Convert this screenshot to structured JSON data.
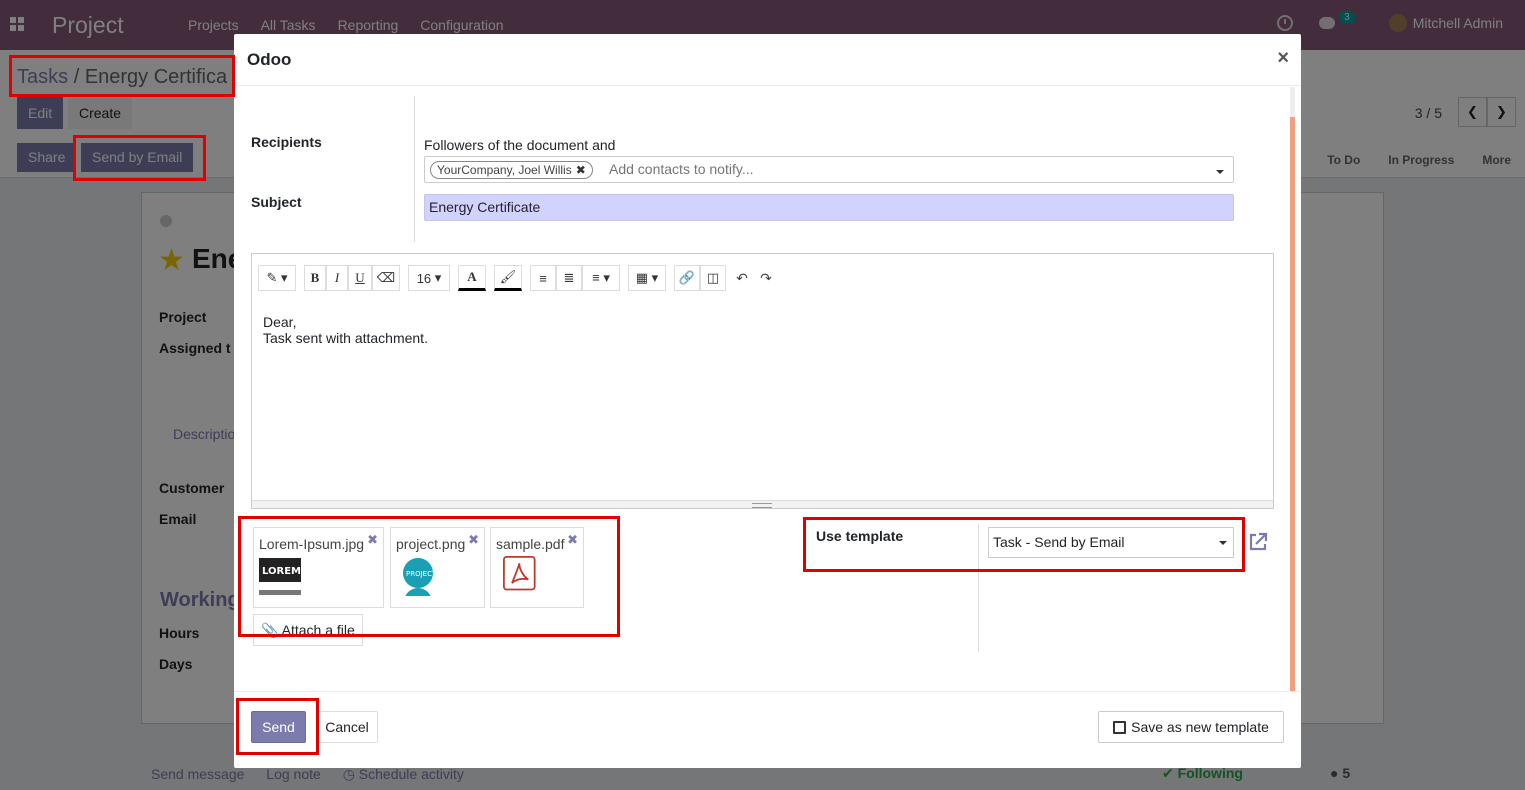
{
  "navbar": {
    "brand": "Project",
    "menu": [
      "Projects",
      "All Tasks",
      "Reporting",
      "Configuration"
    ],
    "chat_count": "3",
    "user": "Mitchell Admin"
  },
  "control_panel": {
    "breadcrumb_parent": "Tasks",
    "breadcrumb_sep": "/",
    "breadcrumb_current": "Energy Certifica",
    "edit_label": "Edit",
    "create_label": "Create",
    "share_label": "Share",
    "send_by_email_label": "Send by Email",
    "pager": "3 / 5",
    "stages": [
      "To Do",
      "In Progress",
      "More"
    ]
  },
  "sheet": {
    "title_fragment": "Ene",
    "project_label": "Project",
    "assigned_label": "Assigned t",
    "description_tab": "Descriptio",
    "customer_label": "Customer",
    "email_label": "Email",
    "working_heading": "Working",
    "hours_label": "Hours",
    "days_label": "Days"
  },
  "chatter": {
    "send_message": "Send message",
    "log_note": "Log note",
    "schedule_activity": "Schedule activity",
    "following": "Following",
    "followers_count": "5"
  },
  "modal": {
    "title": "Odoo",
    "close": "×",
    "recipients_label": "Recipients",
    "followers_text": "Followers of the document and",
    "recipient_tag": "YourCompany, Joel Willis",
    "recipient_placeholder": "Add contacts to notify...",
    "subject_label": "Subject",
    "subject_value": "Energy Certificate",
    "toolbar": {
      "font_size": "16"
    },
    "body_lines": [
      "Dear,",
      "Task sent with attachment."
    ],
    "attachments": [
      {
        "name": "Lorem-Ipsum.jpg"
      },
      {
        "name": "project.png"
      },
      {
        "name": "sample.pdf"
      }
    ],
    "attach_button": "Attach a file",
    "use_template_label": "Use template",
    "template_value": "Task - Send by Email",
    "send_label": "Send",
    "cancel_label": "Cancel",
    "save_template_label": "Save as new template"
  },
  "colors": {
    "navbar": "#875a7b",
    "primary": "#7c7bad",
    "highlight": "#e00000",
    "subject_bg": "#d2d2ff"
  }
}
